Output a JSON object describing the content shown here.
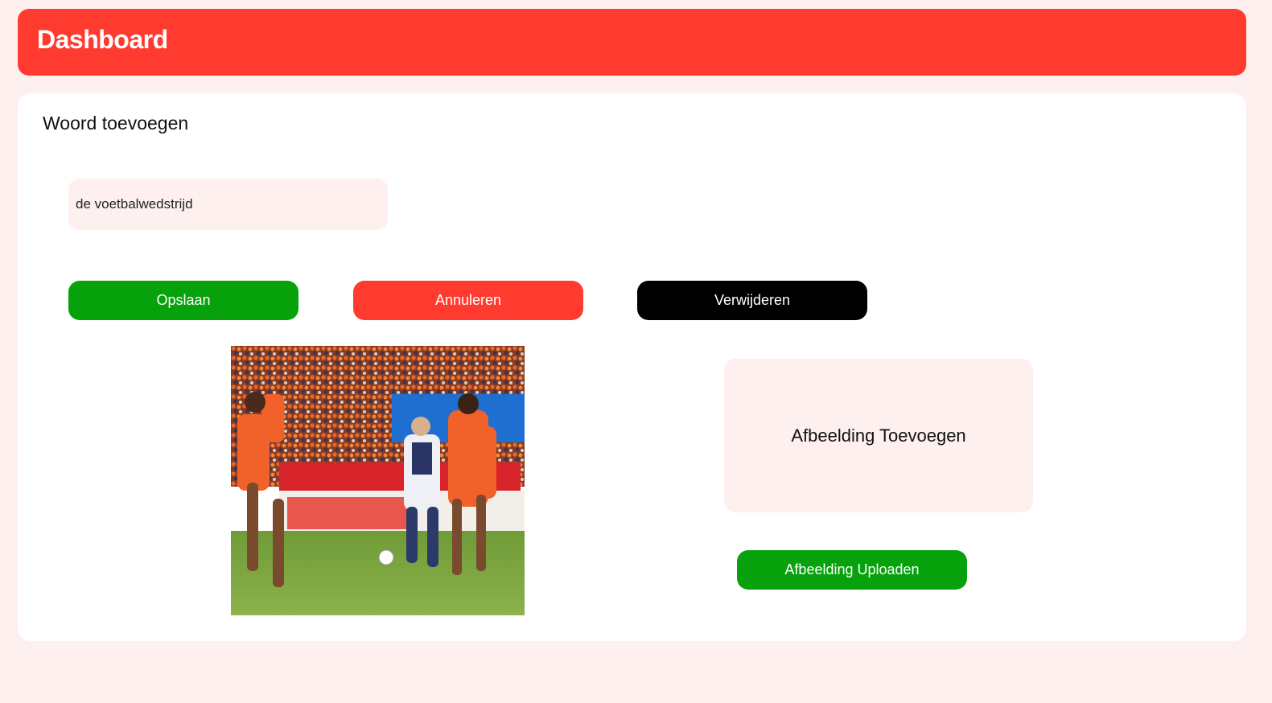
{
  "header": {
    "title": "Dashboard",
    "color": "#ff3b30"
  },
  "form": {
    "title": "Woord toevoegen",
    "word_input": {
      "value": "de voetbalwedstrijd"
    },
    "buttons": {
      "save_label": "Opslaan",
      "cancel_label": "Annuleren",
      "delete_label": "Verwijderen"
    },
    "image": {
      "description": "photo-of-football-match"
    },
    "dropzone": {
      "label": "Afbeelding Toevoegen"
    },
    "upload_label": "Afbeelding Uploaden"
  },
  "colors": {
    "page_background": "#fef0ef",
    "primary_red": "#ff3b30",
    "success_green": "#06a10b",
    "danger_black": "#000000"
  }
}
